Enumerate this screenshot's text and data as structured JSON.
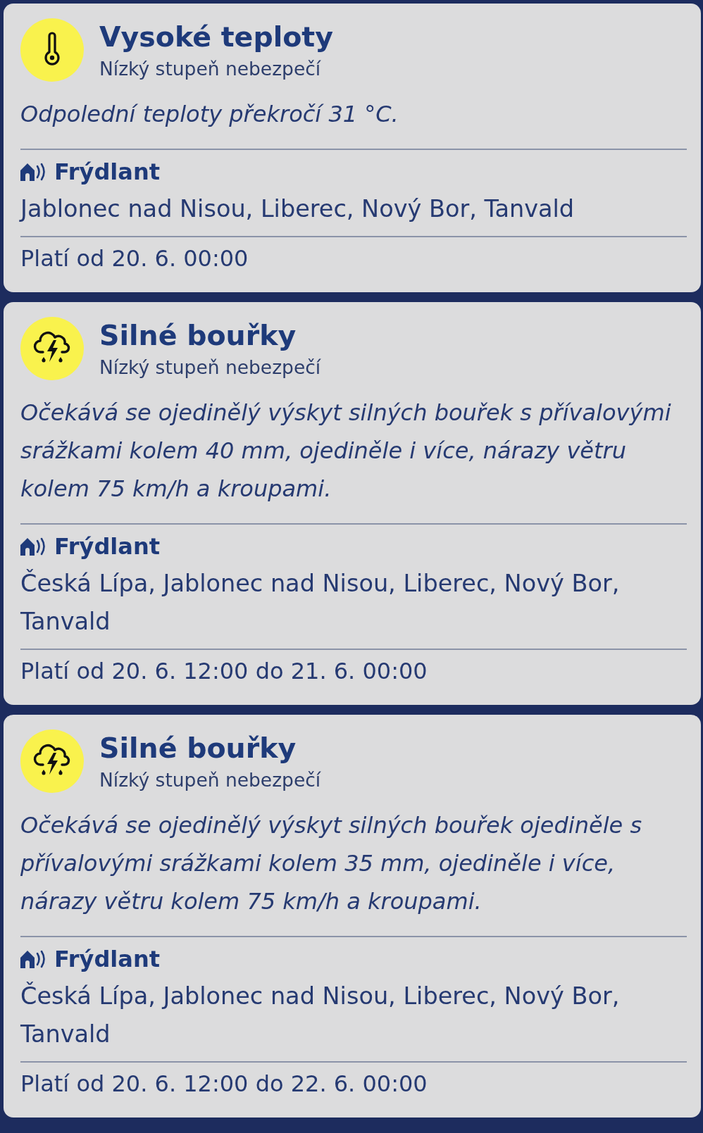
{
  "warnings": [
    {
      "kind": "heat",
      "title": "Vysoké teploty",
      "severity": "Nízký stupeň nebezpečí",
      "description": "Odpolední teploty překročí 31 °C.",
      "region": "Frýdlant",
      "towns": "Jablonec nad Nisou, Liberec, Nový Bor, Tanvald",
      "validity": "Platí od 20. 6. 00:00"
    },
    {
      "kind": "storm",
      "title": "Silné bouřky",
      "severity": "Nízký stupeň nebezpečí",
      "description": "Očekává se ojedinělý výskyt silných bouřek s přívalovými srážkami kolem 40 mm, ojediněle i více, nárazy větru kolem 75 km/h a kroupami.",
      "region": "Frýdlant",
      "towns": "Česká Lípa, Jablonec nad Nisou, Liberec, Nový Bor, Tanvald",
      "validity": "Platí od 20. 6. 12:00 do 21. 6. 00:00"
    },
    {
      "kind": "storm",
      "title": "Silné bouřky",
      "severity": "Nízký stupeň nebezpečí",
      "description": "Očekává se ojedinělý výskyt silných bouřek ojediněle s přívalovými srážkami kolem 35 mm, ojediněle i více, nárazy větru kolem 75 km/h a kroupami.",
      "region": "Frýdlant",
      "towns": "Česká Lípa, Jablonec nad Nisou, Liberec, Nový Bor, Tanvald",
      "validity": "Platí od 20. 6. 12:00 do 22. 6. 00:00"
    }
  ]
}
